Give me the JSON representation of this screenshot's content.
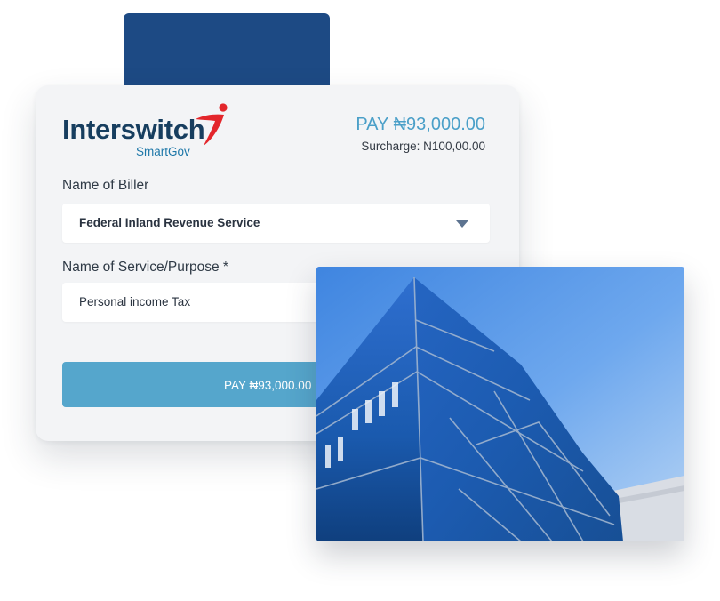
{
  "brand": {
    "name": "Interswitch",
    "product": "SmartGov",
    "mark_color": "#e3262b",
    "text_color": "#173e5f"
  },
  "header": {
    "pay_amount": "PAY ₦93,000.00",
    "surcharge": "Surcharge: N100,00.00"
  },
  "form": {
    "biller_label": "Name of Biller",
    "biller_value": "Federal Inland Revenue Service",
    "service_label": "Name of Service/Purpose *",
    "service_value": "Personal income Tax",
    "submit_label": "PAY ₦93,000.00"
  },
  "colors": {
    "accent": "#55a6cc",
    "navy": "#1d4a84",
    "card_bg": "#f3f4f6"
  },
  "icons": {
    "dropdown": "chevron-down-icon"
  }
}
